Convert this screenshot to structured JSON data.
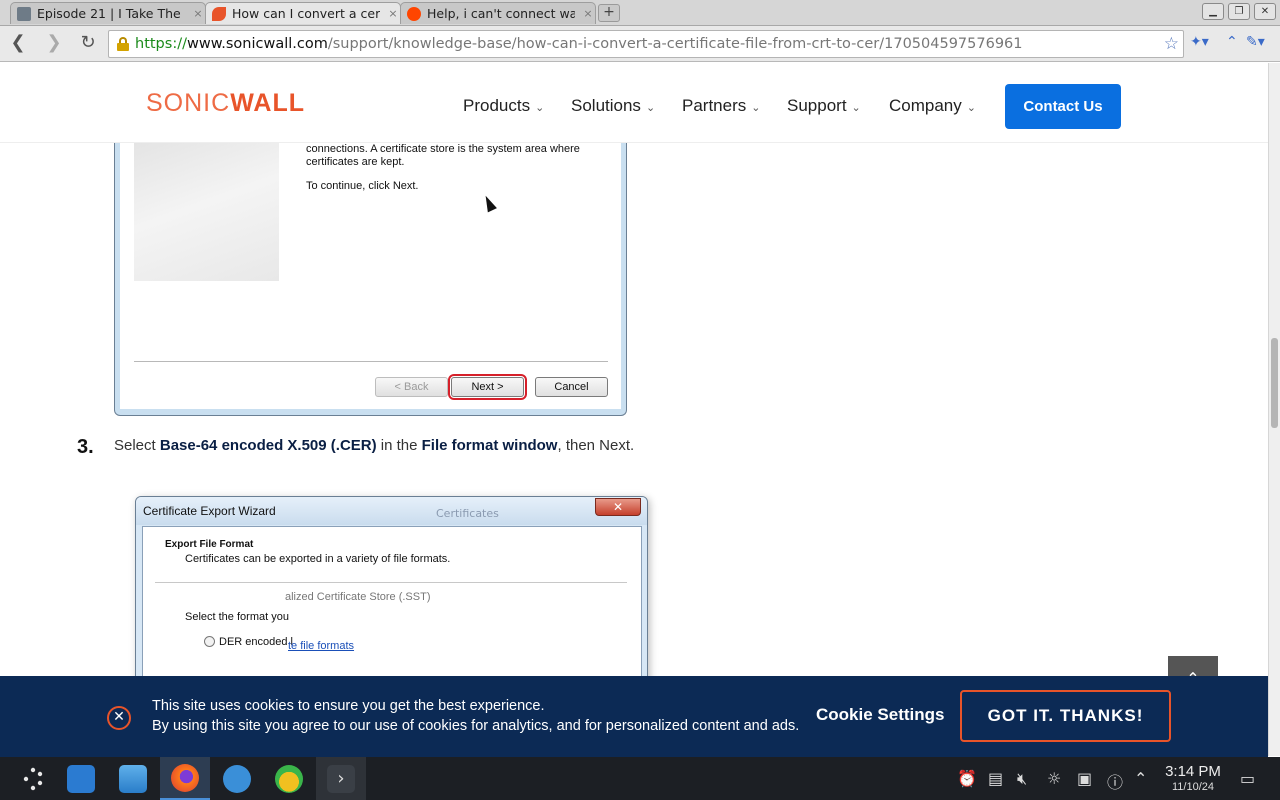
{
  "browser": {
    "tabs": [
      {
        "title": "Episode 21 | I Take The",
        "favicon_color": "#6e7b87"
      },
      {
        "title": "How can I convert a cer",
        "favicon_color": "#e8542a"
      },
      {
        "title": "Help, i can't connect wa",
        "favicon_color": "#ff4500"
      }
    ],
    "new_tab": "+",
    "close_glyph": "×",
    "url": {
      "scheme": "https://",
      "host": "www.sonicwall.com",
      "path": "/support/knowledge-base/how-can-i-convert-a-certificate-file-from-crt-to-cer/170504597576961"
    }
  },
  "site": {
    "logo_sonic": "SONIC",
    "logo_wall": "WALL",
    "nav": [
      "Products",
      "Solutions",
      "Partners",
      "Support",
      "Company"
    ],
    "contact": "Contact Us"
  },
  "wizard1": {
    "line1": "connections. A certificate store is the system area where",
    "line2": "certificates are kept.",
    "line3": "To continue, click Next.",
    "back": "< Back",
    "next": "Next >",
    "cancel": "Cancel"
  },
  "step3": {
    "number": "3.",
    "pre": "Select ",
    "b1": "Base-64 encoded X.509 (.CER)",
    "mid": " in the ",
    "b2": "File format window",
    "post": ", then Next."
  },
  "wizard2": {
    "title": "Certificate Export Wizard",
    "ghost": "Certificates",
    "close": "✕",
    "heading": "Export File Format",
    "sub": "Certificates can be exported in a variety of file formats.",
    "sst": "alized Certificate Store (.SST)",
    "select": "Select the format you",
    "der": "DER encoded l",
    "link": "te file formats"
  },
  "cookie": {
    "line1": "This site uses cookies to ensure you get the best experience.",
    "line2": "By using this site you agree to our use of cookies for analytics, and for personalized content and ads.",
    "settings": "Cookie Settings",
    "accept": "GOT IT. THANKS!"
  },
  "taskbar": {
    "time": "3:14 PM",
    "date": "11/10/24"
  }
}
